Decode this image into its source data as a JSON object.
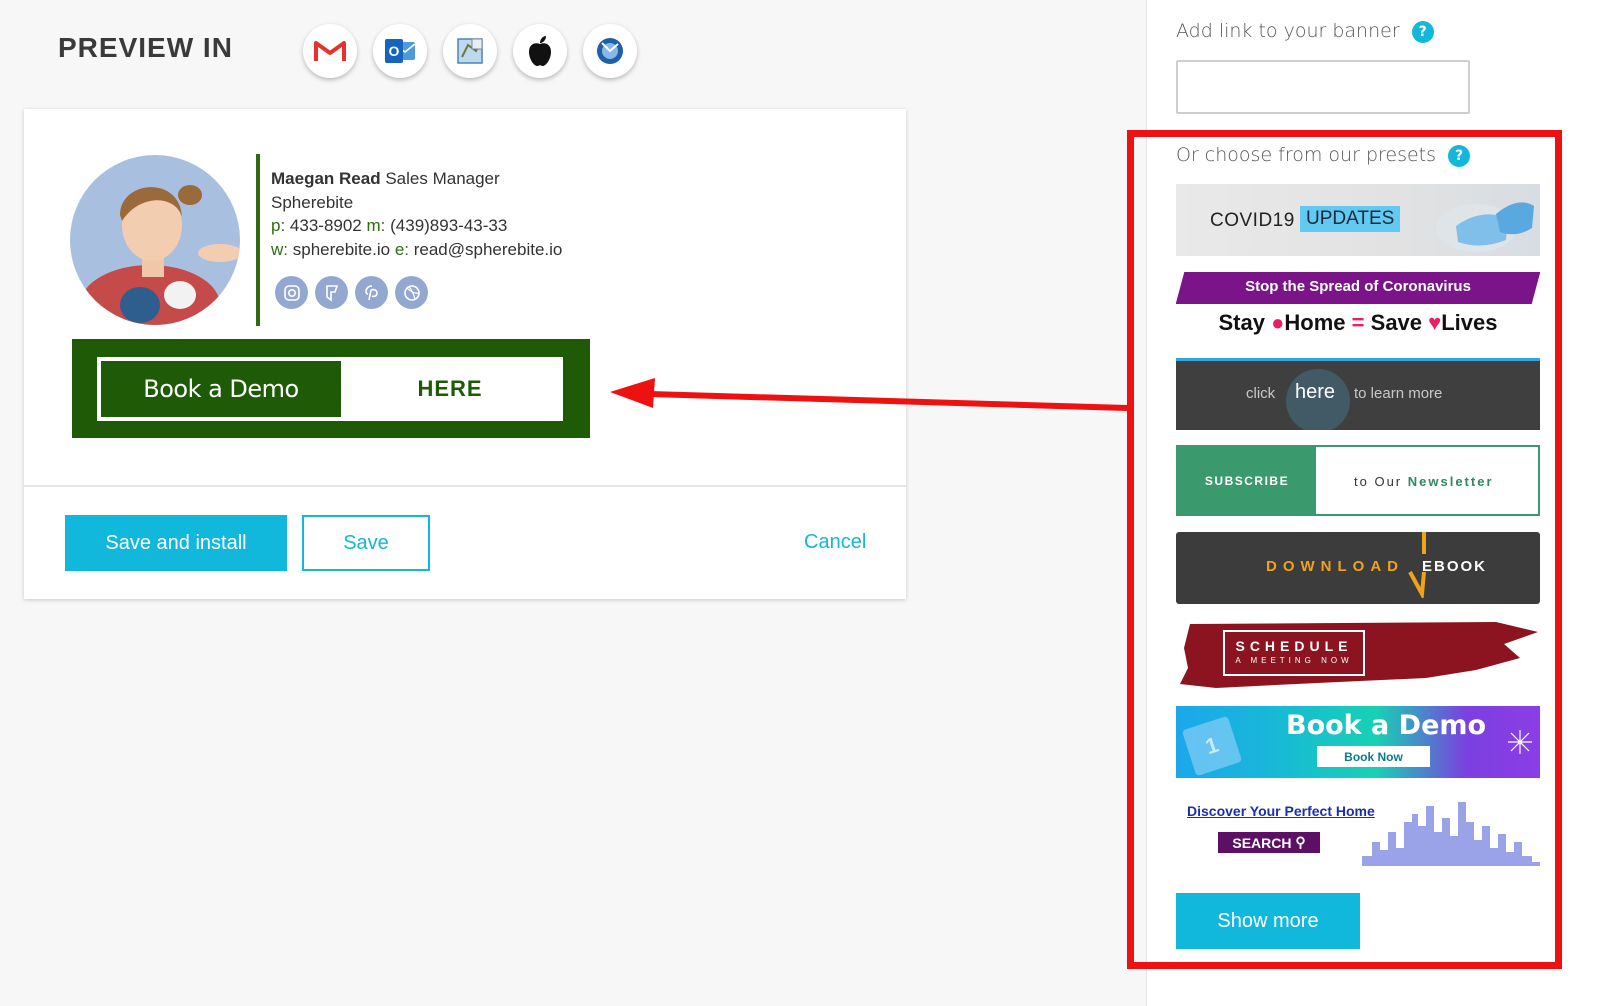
{
  "header": {
    "title": "PREVIEW IN"
  },
  "email_clients": [
    {
      "name": "gmail-icon"
    },
    {
      "name": "outlook-icon"
    },
    {
      "name": "apple-mail-icon"
    },
    {
      "name": "apple-icon"
    },
    {
      "name": "thunderbird-icon"
    }
  ],
  "signature": {
    "name": "Maegan Read",
    "title": "Sales Manager",
    "company": "Spherebite",
    "phone_label": "p:",
    "phone": "433-8902",
    "mobile_label": "m:",
    "mobile": "(439)893-43-33",
    "web_label": "w:",
    "web": "spherebite.io",
    "email_label": "e:",
    "email": "read@spherebite.io",
    "accent_color": "#2e6b12",
    "socials": [
      "instagram-icon",
      "foursquare-icon",
      "pinterest-icon",
      "dribbble-icon"
    ]
  },
  "banner": {
    "left_text": "Book a Demo",
    "right_text": "HERE",
    "color": "#1f5b06"
  },
  "actions": {
    "save_install": "Save and install",
    "save": "Save",
    "cancel": "Cancel"
  },
  "right_panel": {
    "link_label": "Add link to your banner",
    "link_value": "",
    "help": "?",
    "presets_label": "Or choose from our presets",
    "presets": {
      "covid": {
        "word1": "COVID19",
        "word2": "UPDATES"
      },
      "stay_home": {
        "line1": "Stop the Spread of Coronavirus",
        "w1": "Stay",
        "w2": "Home",
        "eq": "=",
        "w3": "Save",
        "w4": "Lives"
      },
      "click_here": {
        "t1": "click",
        "t2": "here",
        "t3": "to learn more"
      },
      "newsletter": {
        "left": "SUBSCRIBE",
        "mid": "to Our",
        "strong": "Newsletter"
      },
      "ebook": {
        "left": "DOWNLOAD",
        "right": "EBOOK"
      },
      "schedule": {
        "line1": "SCHEDULE",
        "line2": "A MEETING NOW"
      },
      "book_demo": {
        "title": "Book a Demo",
        "button": "Book Now",
        "tile": "1"
      },
      "home": {
        "title": "Discover Your Perfect Home",
        "button": "SEARCH"
      }
    },
    "show_more": "Show more"
  },
  "colors": {
    "accent": "#12b7dc",
    "annotation": "#ee1111"
  }
}
